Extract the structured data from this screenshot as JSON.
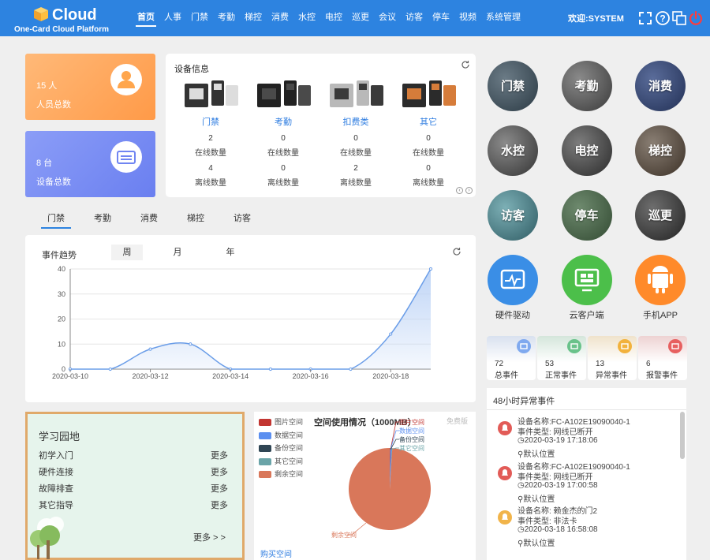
{
  "header": {
    "logo_text": "Cloud",
    "logo_sub": "One-Card Cloud Platform",
    "nav": [
      "首页",
      "人事",
      "门禁",
      "考勤",
      "梯控",
      "消费",
      "水控",
      "电控",
      "巡更",
      "会议",
      "访客",
      "停车",
      "视频",
      "系统管理"
    ],
    "welcome": "欢迎:SYSTEM",
    "icons": [
      "fullscreen-icon",
      "help-icon",
      "window-icon",
      "power-icon"
    ]
  },
  "stats": {
    "people_value": "15 人",
    "people_label": "人员总数",
    "device_value": "8 台",
    "device_label": "设备总数"
  },
  "devices": {
    "title": "设备信息",
    "online_label": "在线数量",
    "offline_label": "离线数量",
    "types": [
      {
        "name": "门禁",
        "online": "2",
        "offline": "4"
      },
      {
        "name": "考勤",
        "online": "0",
        "offline": "0"
      },
      {
        "name": "扣费类",
        "online": "0",
        "offline": "2"
      },
      {
        "name": "其它",
        "online": "0",
        "offline": "0"
      }
    ]
  },
  "tabs": [
    "门禁",
    "考勤",
    "消费",
    "梯控",
    "访客"
  ],
  "trend": {
    "title": "事件趋势",
    "periods": [
      "周",
      "月",
      "年"
    ]
  },
  "chart_data": {
    "type": "area",
    "title": "事件趋势",
    "x": [
      "2020-03-10",
      "2020-03-11",
      "2020-03-12",
      "2020-03-13",
      "2020-03-14",
      "2020-03-15",
      "2020-03-16",
      "2020-03-17",
      "2020-03-18",
      "2020-03-19"
    ],
    "xticks": [
      "2020-03-10",
      "2020-03-12",
      "2020-03-14",
      "2020-03-16",
      "2020-03-18"
    ],
    "values": [
      0,
      0,
      8,
      10,
      0,
      0,
      0,
      0,
      14,
      40
    ],
    "ylim": [
      0,
      40
    ],
    "yticks": [
      0,
      10,
      20,
      30,
      40
    ],
    "grid": true,
    "colors": {
      "line": "#6a9de8",
      "fill": "#bcd3f6"
    }
  },
  "study": {
    "title": "学习园地",
    "items": [
      "初学入门",
      "硬件连接",
      "故障排查",
      "其它指导"
    ],
    "more_label": "更多",
    "more_all": "更多 > >"
  },
  "space": {
    "title": "空间使用情况（1000MB）",
    "free_version": "免费版",
    "buy": "购买空间",
    "legend": [
      {
        "name": "图片空间",
        "color": "#c23531"
      },
      {
        "name": "数据空间",
        "color": "#5b8ff0"
      },
      {
        "name": "备份空间",
        "color": "#2f4554"
      },
      {
        "name": "其它空间",
        "color": "#6aa4a8"
      },
      {
        "name": "剩余空间",
        "color": "#d9775a"
      }
    ],
    "pie_values": [
      2,
      6,
      1,
      1,
      990
    ],
    "label_remaining": "剩余空间"
  },
  "modules": [
    {
      "name": "门禁",
      "icon": "door-access-icon"
    },
    {
      "name": "考勤",
      "icon": "attendance-icon"
    },
    {
      "name": "消费",
      "icon": "consume-icon"
    },
    {
      "name": "水控",
      "icon": "water-control-icon"
    },
    {
      "name": "电控",
      "icon": "power-control-icon"
    },
    {
      "name": "梯控",
      "icon": "elevator-icon"
    },
    {
      "name": "访客",
      "icon": "visitor-icon"
    },
    {
      "name": "停车",
      "icon": "parking-icon"
    },
    {
      "name": "巡更",
      "icon": "patrol-icon"
    }
  ],
  "apps": [
    {
      "name": "硬件驱动",
      "color": "#3a8ee6"
    },
    {
      "name": "云客户端",
      "color": "#4cbf4a"
    },
    {
      "name": "手机APP",
      "color": "#ff8a2a"
    }
  ],
  "events": [
    {
      "count": "72",
      "label": "总事件",
      "color": "#7fa9ef"
    },
    {
      "count": "53",
      "label": "正常事件",
      "color": "#69c28a"
    },
    {
      "count": "13",
      "label": "异常事件",
      "color": "#f2b23d"
    },
    {
      "count": "6",
      "label": "报警事件",
      "color": "#e76060"
    }
  ],
  "alarms": {
    "title": "48小时异常事件",
    "items": [
      {
        "device": "设备名称:FC-A102E19090040-1",
        "type": "事件类型: 网线已断开",
        "time": "2020-03-19 17:18:06",
        "loc": "默认位置",
        "color": "#e25b57"
      },
      {
        "device": "设备名称:FC-A102E19090040-1",
        "type": "事件类型: 网线已断开",
        "time": "2020-03-19 17:00:58",
        "loc": "默认位置",
        "color": "#e25b57"
      },
      {
        "device": "设备名称: 赖金杰的门2",
        "type": "事件类型: 非法卡",
        "time": "2020-03-18 16:58:08",
        "loc": "默认位置",
        "color": "#f1b44a"
      }
    ]
  }
}
